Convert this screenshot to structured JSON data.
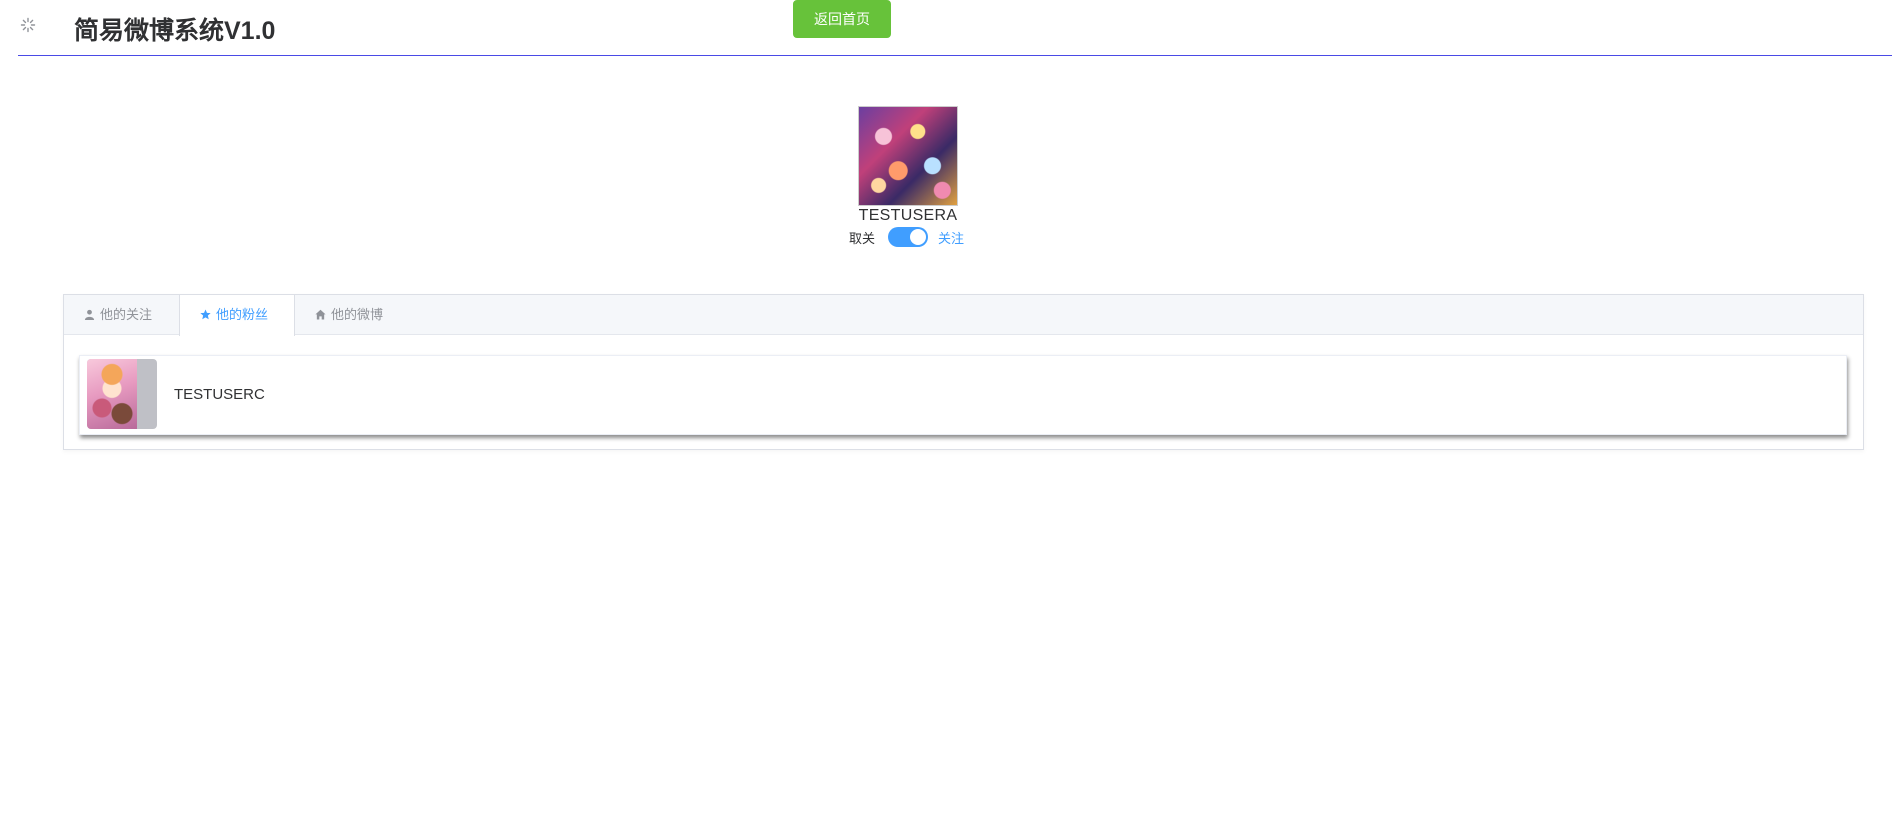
{
  "header": {
    "title": "简易微博系统V1.0",
    "home_button_label": "返回首页",
    "loading_icon": "loading-spinner-icon",
    "divider_color": "#4a4ae6"
  },
  "profile": {
    "username": "TESTUSERA",
    "unfollow_label": "取关",
    "follow_label": "关注",
    "follow_switch_on": true,
    "accent_color": "#409eff"
  },
  "tabs": [
    {
      "label": "他的关注",
      "icon": "user-icon",
      "active": false
    },
    {
      "label": "他的粉丝",
      "icon": "star-icon",
      "active": true
    },
    {
      "label": "他的微博",
      "icon": "home-icon",
      "active": false
    }
  ],
  "fans": [
    {
      "name": "TESTUSERC"
    }
  ],
  "colors": {
    "home_button": "#67c23a",
    "tab_active": "#409eff",
    "tab_inactive": "#909399"
  }
}
